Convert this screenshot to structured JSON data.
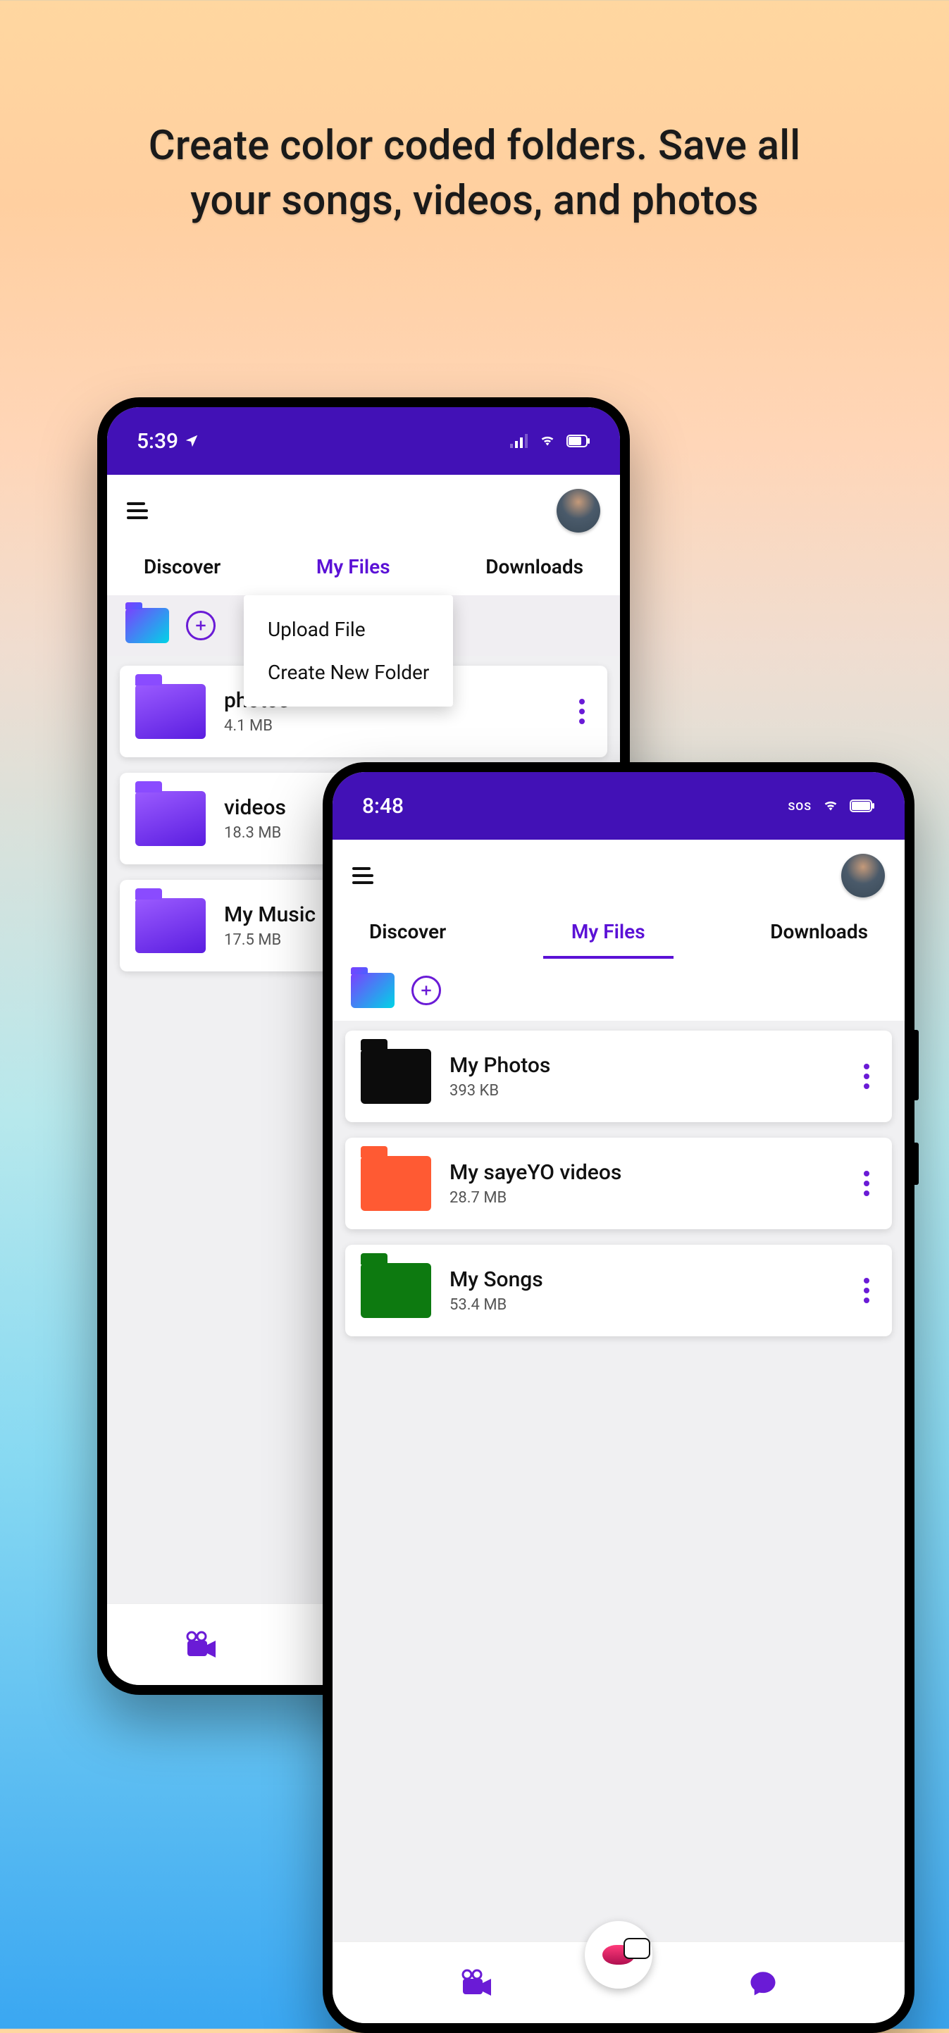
{
  "headline_l1": "Create color coded folders. Save all",
  "headline_l2": "your songs, videos, and photos",
  "colors": {
    "accent": "#4211b6",
    "active": "#5b11d6"
  },
  "tabs": {
    "discover": "Discover",
    "myfiles": "My Files",
    "downloads": "Downloads"
  },
  "popup": {
    "upload": "Upload File",
    "create": "Create New Folder"
  },
  "left_phone": {
    "time": "5:39",
    "folders": [
      {
        "name": "photos",
        "size": "4.1 MB"
      },
      {
        "name": "videos",
        "size": "18.3 MB"
      },
      {
        "name": "My Music",
        "size": "17.5 MB"
      }
    ]
  },
  "right_phone": {
    "time": "8:48",
    "sos": "SOS",
    "folders": [
      {
        "name": "My Photos",
        "size": "393 KB"
      },
      {
        "name": "My sayeYO videos",
        "size": "28.7 MB"
      },
      {
        "name": "My Songs",
        "size": "53.4 MB"
      }
    ]
  }
}
